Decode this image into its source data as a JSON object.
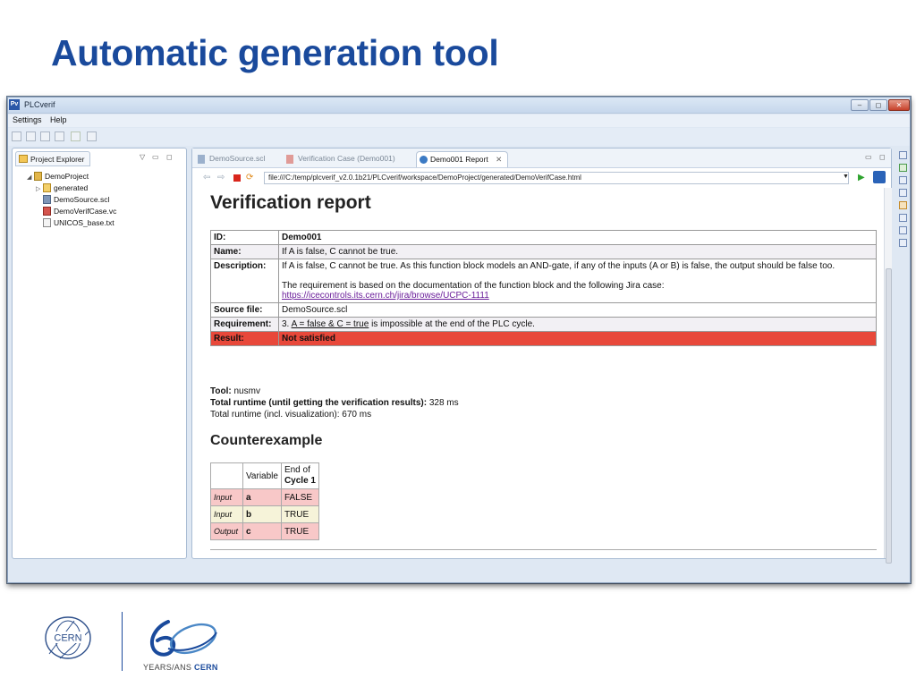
{
  "slide": {
    "title": "Automatic generation tool"
  },
  "window": {
    "app_icon": "Pv",
    "title": "PLCverif",
    "controls": {
      "minimize": "–",
      "maximize": "◻",
      "close": "✕"
    },
    "menu": [
      "Settings",
      "Help"
    ]
  },
  "explorer": {
    "tab_label": "Project Explorer",
    "tree": {
      "project": "DemoProject",
      "folder": "generated",
      "files": [
        "DemoSource.scl",
        "DemoVerifCase.vc",
        "UNICOS_base.txt"
      ]
    }
  },
  "editor": {
    "tabs": [
      "DemoSource.scl",
      "Verification Case (Demo001)",
      "Demo001 Report"
    ],
    "tab_close": "✕",
    "url": "file:///C:/temp/plcverif_v2.0.1b21/PLCverif/workspace/DemoProject/generated/DemoVerifCase.html"
  },
  "report": {
    "heading": "Verification report",
    "rows": {
      "id_label": "ID:",
      "id_value": "Demo001",
      "name_label": "Name:",
      "name_value": "If A is false, C cannot be true.",
      "desc_label": "Description:",
      "desc_value_1": "If A is false, C cannot be true. As this function block models an AND-gate, if any of the inputs (A or B) is false, the output should be false too.",
      "desc_value_2": "The requirement is based on the documentation of the function block and the following Jira case:",
      "desc_link": "https://icecontrols.its.cern.ch/jira/browse/UCPC-1111",
      "source_label": "Source file:",
      "source_value": "DemoSource.scl",
      "req_label": "Requirement:",
      "req_prefix": "3.",
      "req_expr": "A = false & C = true",
      "req_suffix": "is impossible at the end of the PLC cycle.",
      "result_label": "Result:",
      "result_value": "Not satisfied"
    },
    "tool": {
      "tool_label": "Tool:",
      "tool_value": "nusmv",
      "runtime_label": "Total runtime (until getting the verification results):",
      "runtime_value": "328 ms",
      "runtime_vis": "Total runtime (incl. visualization): 670 ms"
    },
    "counterexample": {
      "heading": "Counterexample",
      "col_variable": "Variable",
      "col_end": "End of",
      "col_cycle": "Cycle 1",
      "rows": [
        {
          "dir": "Input",
          "var": "a",
          "val": "FALSE"
        },
        {
          "dir": "Input",
          "var": "b",
          "val": "TRUE"
        },
        {
          "dir": "Output",
          "var": "c",
          "val": "TRUE"
        }
      ]
    }
  },
  "footer": {
    "cern_logo_text": "CERN",
    "tagline_prefix": "YEARS/ANS",
    "tagline_brand": "CERN"
  },
  "colors": {
    "title_blue": "#1a4a9c",
    "result_red": "#e8483a",
    "input_pink": "#f8c8c8"
  }
}
